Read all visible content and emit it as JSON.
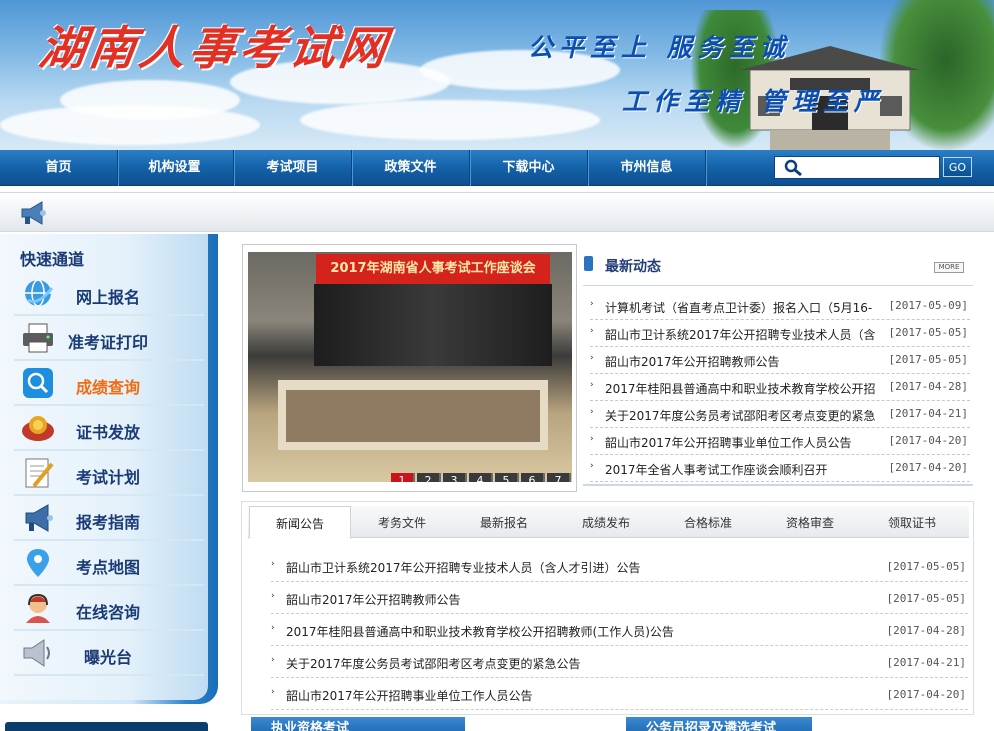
{
  "banner": {
    "site_title": "湖南人事考试网",
    "slogan_1": "公平至上 服务至诚",
    "slogan_2": "工作至精 管理至严"
  },
  "nav": {
    "items": [
      "首页",
      "机构设置",
      "考试项目",
      "政策文件",
      "下载中心",
      "市州信息"
    ],
    "search_placeholder": "",
    "go_label": "GO"
  },
  "sidebar": {
    "title": "快速通道",
    "items": [
      {
        "label": "网上报名",
        "icon": "globe-icon"
      },
      {
        "label": "准考证打印",
        "icon": "printer-icon"
      },
      {
        "label": "成绩查询",
        "icon": "magnifier-icon",
        "active": true
      },
      {
        "label": "证书发放",
        "icon": "certificate-icon"
      },
      {
        "label": "考试计划",
        "icon": "notepad-icon"
      },
      {
        "label": "报考指南",
        "icon": "megaphone-icon"
      },
      {
        "label": "考点地图",
        "icon": "map-pin-icon"
      },
      {
        "label": "在线咨询",
        "icon": "headset-icon"
      },
      {
        "label": "曝光台",
        "icon": "speaker-icon"
      }
    ]
  },
  "slideshow": {
    "banner_text": "2017年湖南省人事考试工作座谈会",
    "buttons": [
      "1",
      "2",
      "3",
      "4",
      "5",
      "6",
      "7"
    ],
    "active": "1"
  },
  "news": {
    "title": "最新动态",
    "more": "MORE",
    "items": [
      {
        "text": "计算机考试（省直考点卫计委）报名入口（5月16-",
        "date": "[2017-05-09]"
      },
      {
        "text": "韶山市卫计系统2017年公开招聘专业技术人员（含",
        "date": "[2017-05-05]"
      },
      {
        "text": "韶山市2017年公开招聘教师公告",
        "date": "[2017-05-05]"
      },
      {
        "text": "2017年桂阳县普通高中和职业技术教育学校公开招",
        "date": "[2017-04-28]"
      },
      {
        "text": "关于2017年度公务员考试邵阳考区考点变更的紧急",
        "date": "[2017-04-21]"
      },
      {
        "text": "韶山市2017年公开招聘事业单位工作人员公告",
        "date": "[2017-04-20]"
      },
      {
        "text": "2017年全省人事考试工作座谈会顺利召开",
        "date": "[2017-04-20]"
      }
    ]
  },
  "tabs": {
    "labels": [
      "新闻公告",
      "考务文件",
      "最新报名",
      "成绩发布",
      "合格标准",
      "资格审查",
      "领取证书"
    ],
    "active": "新闻公告",
    "items": [
      {
        "text": "韶山市卫计系统2017年公开招聘专业技术人员（含人才引进）公告",
        "date": "[2017-05-05]"
      },
      {
        "text": "韶山市2017年公开招聘教师公告",
        "date": "[2017-05-05]"
      },
      {
        "text": "2017年桂阳县普通高中和职业技术教育学校公开招聘教师(工作人员)公告",
        "date": "[2017-04-28]"
      },
      {
        "text": "关于2017年度公务员考试邵阳考区考点变更的紧急公告",
        "date": "[2017-04-21]"
      },
      {
        "text": "韶山市2017年公开招聘事业单位工作人员公告",
        "date": "[2017-04-20]"
      }
    ]
  },
  "bottom": {
    "heading_1": "执业资格考试",
    "heading_2": "公务员招录及遴选考试"
  },
  "colors": {
    "nav_blue": "#1462a9",
    "title_red": "#e23024",
    "slogan_blue": "#0c4fb0",
    "active_orange": "#f26b10",
    "slide_active": "#c8141c"
  }
}
